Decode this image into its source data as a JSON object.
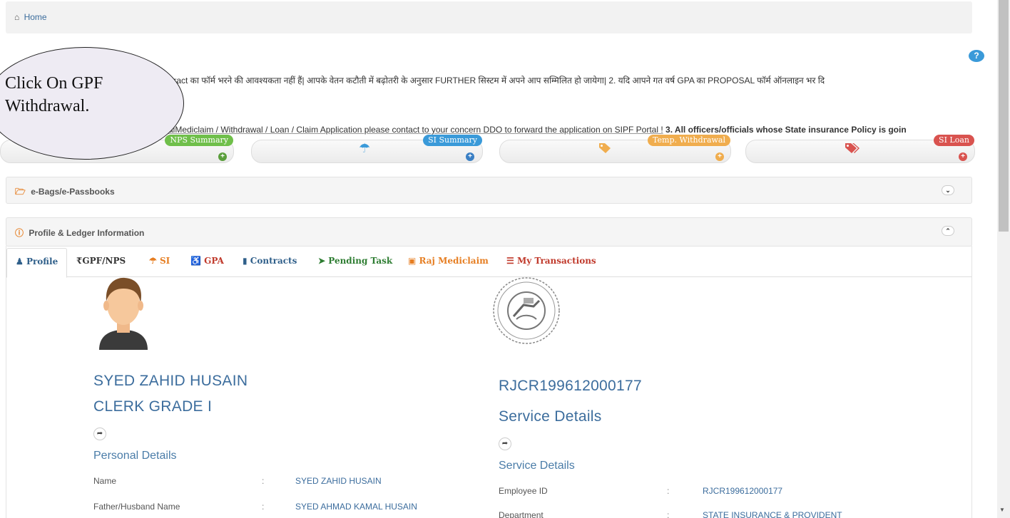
{
  "breadcrumb": {
    "label": "Home"
  },
  "help_icon": "?",
  "marquee": {
    "line1": "tract का फॉर्म भरने की आवश्यकता नहीं हैं| आपके वेतन कटौती में बढ़ोतरी के अनुसार FURTHER सिस्टम में अपने आप सम्मिलित हो जायेगा|   2. यदि आपने गत वर्ष GPA का PROPOSAL फॉर्म ऑनलाइन भर दि",
    "line2_plain": "kaiMediclaim / Withdrawal / Loan / Claim Application please contact to your concern DDO to forward the application on SIPF Portal !",
    "line2_bold": "3. All officers/officials whose State insurance Policy is goin"
  },
  "tiles": [
    {
      "badge": "NPS Summary",
      "color": "#6fbf4a",
      "icon": "none"
    },
    {
      "badge": "SI Summary",
      "color": "#3a9ad9",
      "icon": "umbrella-icon"
    },
    {
      "badge": "Temp. Withdrawal",
      "color": "#f0ad4e",
      "icon": "tag-icon"
    },
    {
      "badge": "SI Loan",
      "color": "#d9534f",
      "icon": "tags-icon"
    }
  ],
  "panels": {
    "ebags": "e-Bags/e-Passbooks",
    "profile": "Profile & Ledger Information"
  },
  "tabs": [
    {
      "label": "Profile",
      "icon": "user-icon",
      "color": "#2f5f8a"
    },
    {
      "label": "GPF/NPS",
      "icon": "rupee-icon",
      "color": "#333"
    },
    {
      "label": "SI",
      "icon": "umbrella-icon",
      "color": "#e67e22"
    },
    {
      "label": "GPA",
      "icon": "wheelchair-icon",
      "color": "#c0392b"
    },
    {
      "label": "Contracts",
      "icon": "file-icon",
      "color": "#2f5f8a"
    },
    {
      "label": "Pending Task",
      "icon": "send-icon",
      "color": "#2e7d32"
    },
    {
      "label": "Raj Mediclaim",
      "icon": "briefcase-icon",
      "color": "#e67e22"
    },
    {
      "label": "My Transactions",
      "icon": "list-icon",
      "color": "#c0392b"
    }
  ],
  "profile": {
    "name_heading": "SYED ZAHID HUSAIN",
    "designation": "CLERK GRADE I",
    "personal_details_title": "Personal Details",
    "rows": [
      {
        "label": "Name",
        "value": "SYED ZAHID HUSAIN"
      },
      {
        "label": "Father/Husband Name",
        "value": "SYED AHMAD KAMAL HUSAIN"
      }
    ]
  },
  "service": {
    "employee_id_heading": "RJCR199612000177",
    "service_details_heading": "Service Details",
    "service_details_title": "Service Details",
    "rows": [
      {
        "label": "Employee ID",
        "value": "RJCR199612000177"
      },
      {
        "label": "Department",
        "value": "STATE INSURANCE & PROVIDENT"
      }
    ]
  },
  "callout": {
    "line1": "Click On GPF",
    "line2": "Withdrawal."
  }
}
